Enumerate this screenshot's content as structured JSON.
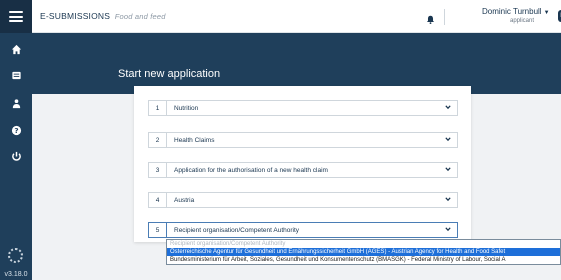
{
  "app": {
    "brand": "E-SUBMISSIONS",
    "brand_sub": "Food and feed",
    "version": "v3.18.0"
  },
  "user": {
    "name": "Dominic Turnbull",
    "role": "applicant",
    "language": "EN"
  },
  "sidebar": {
    "items": [
      {
        "name": "home-icon"
      },
      {
        "name": "inbox-icon"
      },
      {
        "name": "users-icon"
      },
      {
        "name": "help-icon"
      },
      {
        "name": "power-icon"
      }
    ]
  },
  "main": {
    "title": "Start new application",
    "steps": [
      {
        "num": "1",
        "value": "Nutrition"
      },
      {
        "num": "2",
        "value": "Health Claims"
      },
      {
        "num": "3",
        "value": "Application for the authorisation of a new health claim"
      },
      {
        "num": "4",
        "value": "Austria"
      },
      {
        "num": "5",
        "value": "Recipient organisation/Competent Authority"
      }
    ],
    "dropdown_options": [
      {
        "label": "Recipient organisation/Competent Authority",
        "state": "disabled"
      },
      {
        "label": "Österreichische Agentur für Gesundheit und Ernährungssicherheit GmbH (AGES) - Austrian Agency for Health and Food Safet",
        "state": "selected"
      },
      {
        "label": "Bundesministerium für Arbeit, Soziales, Gesundheit und Konsumentenschutz (BMASGK) - Federal Ministry of Labour, Social A",
        "state": "normal"
      }
    ]
  },
  "colors": {
    "sidebar": "#1f3f5b",
    "banner": "#1f3f5b",
    "accent": "#1e6fd9"
  }
}
